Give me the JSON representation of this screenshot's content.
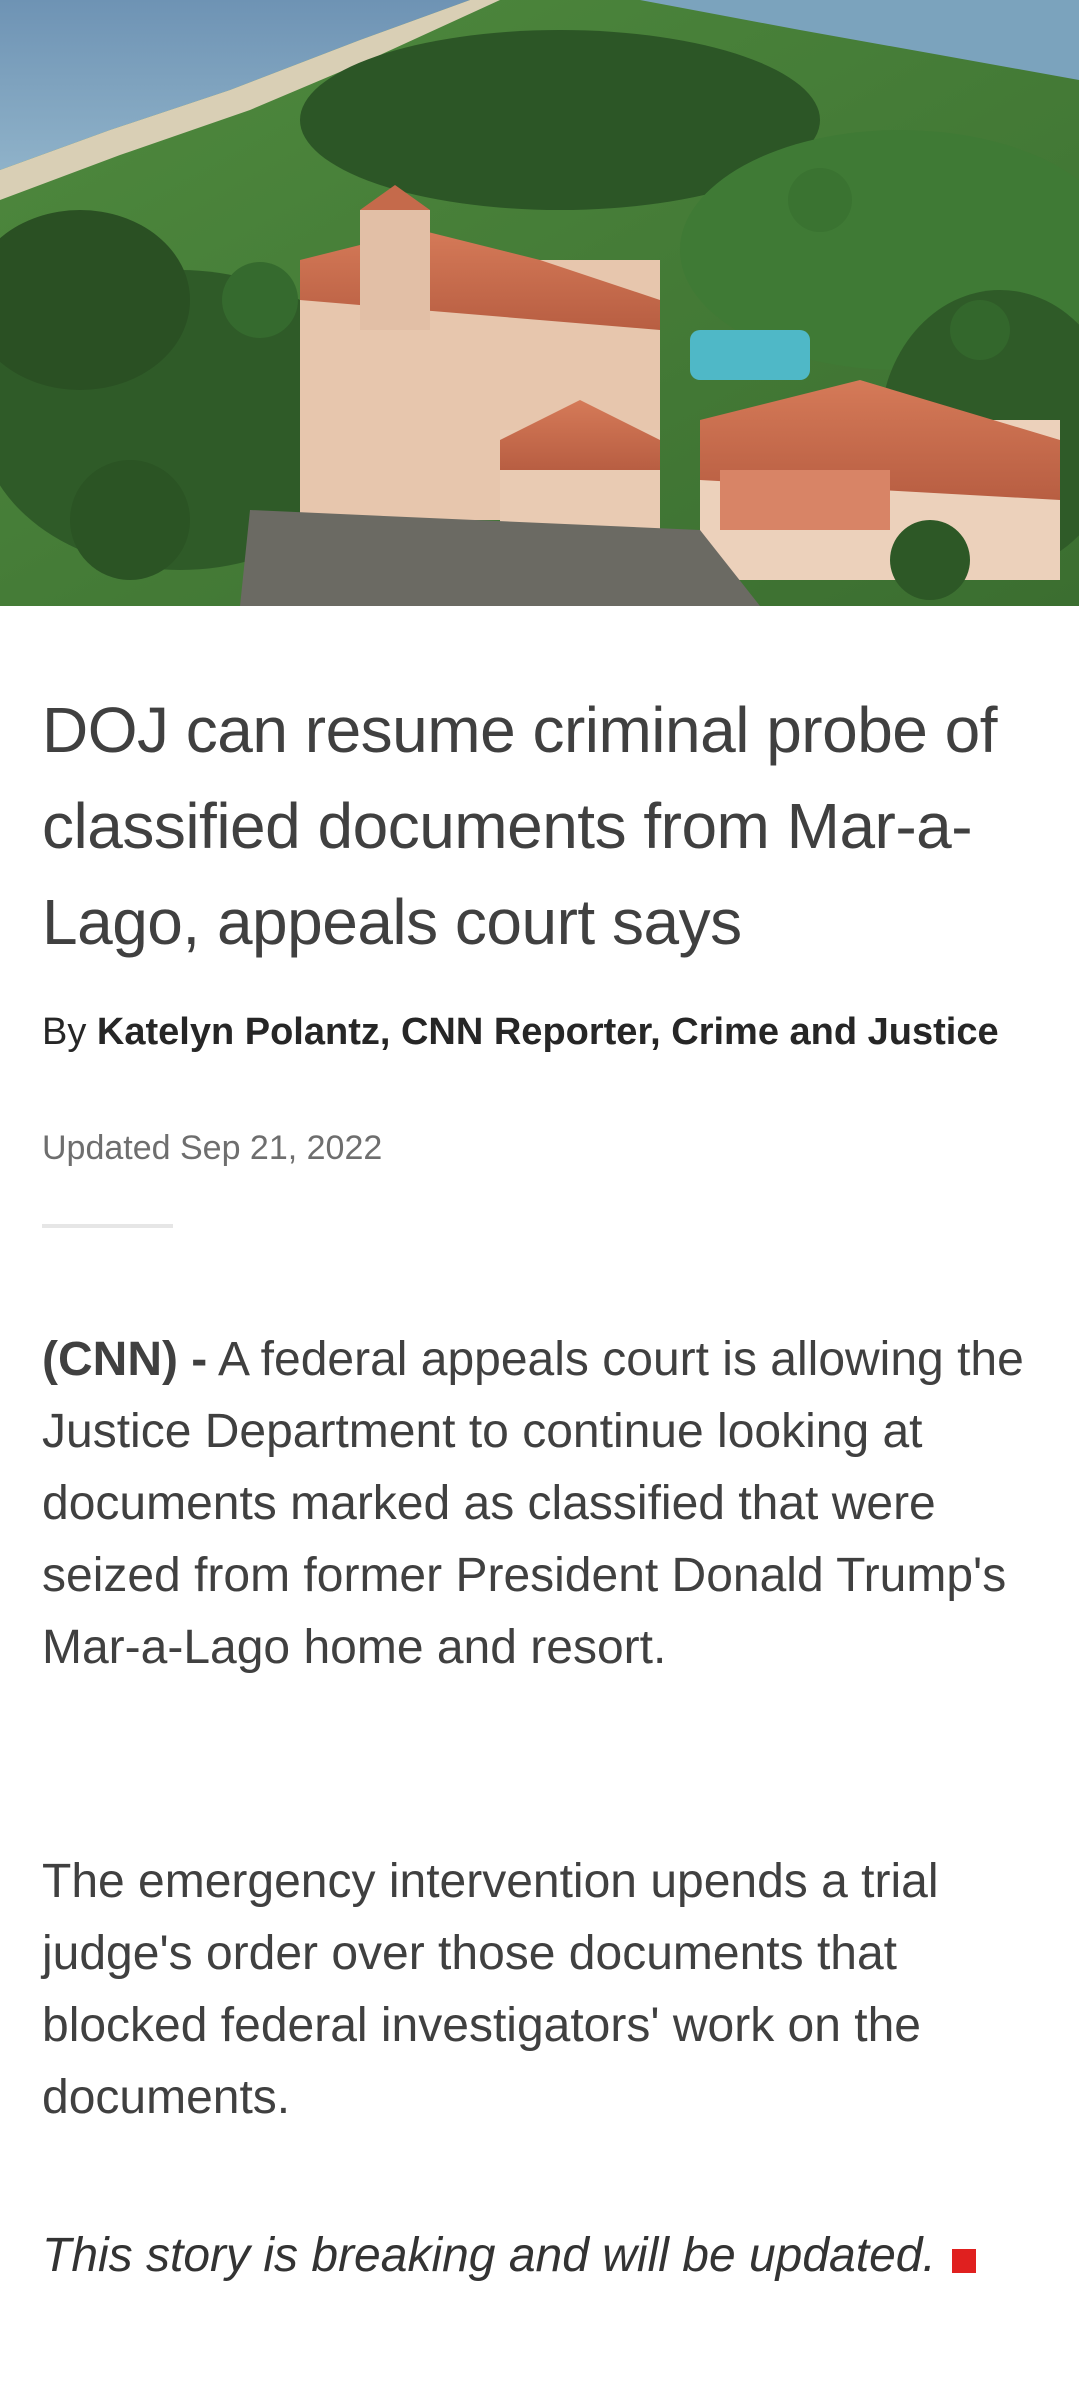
{
  "hero": {
    "image_description_icon": "aerial-estate-photo"
  },
  "article": {
    "headline": "DOJ can resume criminal probe of classified documents from Mar-a-Lago, appeals court says",
    "byline_prefix": "By",
    "byline_author": "Katelyn Polantz, CNN Reporter, Crime and Justice",
    "updated": "Updated Sep 21, 2022",
    "source_tag": "(CNN) -",
    "paragraph1": "A federal appeals court is allowing the Justice Department to continue looking at documents marked as classified that were seized from former President Donald Trump's Mar-a-Lago home and resort.",
    "paragraph2": "The emergency intervention upends a trial judge's order over those documents that blocked federal investigators' work on the documents.",
    "paragraph3": "This story is breaking and will be updated."
  },
  "colors": {
    "end_marker": "#e0201f",
    "text": "#404040"
  }
}
